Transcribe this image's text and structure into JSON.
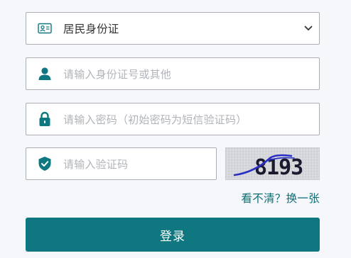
{
  "form": {
    "id_type": {
      "selected": "居民身份证",
      "icon": "id-card-icon"
    },
    "id_number": {
      "placeholder": "请输入身份证号或其他",
      "icon": "user-icon"
    },
    "password": {
      "placeholder": "请输入密码（初始密码为短信验证码）",
      "icon": "lock-icon"
    },
    "captcha": {
      "placeholder": "请输入验证码",
      "icon": "shield-check-icon",
      "image_text": "8193"
    },
    "refresh_label": "看不清？换一张",
    "login_label": "登录"
  },
  "colors": {
    "accent": "#0e7780",
    "link": "#0d6e78",
    "border": "#a9aeb5",
    "placeholder": "#b0b4ba"
  }
}
